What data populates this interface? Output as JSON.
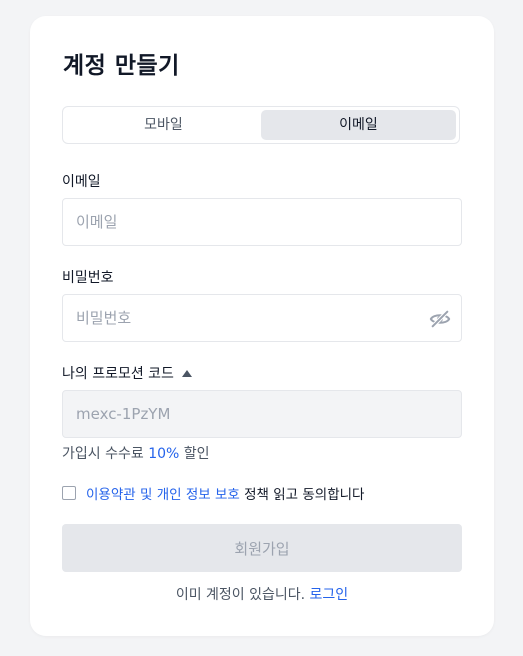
{
  "page": {
    "title": "계정 만들기"
  },
  "tabs": [
    {
      "label": "모바일",
      "active": false
    },
    {
      "label": "이메일",
      "active": true
    }
  ],
  "email": {
    "label": "이메일",
    "placeholder": "이메일",
    "value": ""
  },
  "password": {
    "label": "비밀번호",
    "placeholder": "비밀번호",
    "value": "",
    "toggle_icon": "eye-off-icon"
  },
  "promo": {
    "label": "나의 프로모션 코드",
    "toggle_icon": "caret-up-icon",
    "value": "mexc-1PzYM",
    "fee_prefix": "가입시 수수료 ",
    "fee_value": "10%",
    "fee_suffix": " 할인"
  },
  "agreement": {
    "checked": false,
    "terms_link": "이용약관",
    "and_text": " 및 ",
    "privacy_link": "개인 정보 보호",
    "suffix": " 정책 읽고 동의합니다"
  },
  "submit": {
    "label": "회원가입"
  },
  "login": {
    "prompt": "이미 계정이 있습니다. ",
    "link": "로그인"
  },
  "colors": {
    "background": "#f3f4f6",
    "card": "#ffffff",
    "accent": "#2563eb",
    "disabled_button": "#e5e7eb"
  }
}
